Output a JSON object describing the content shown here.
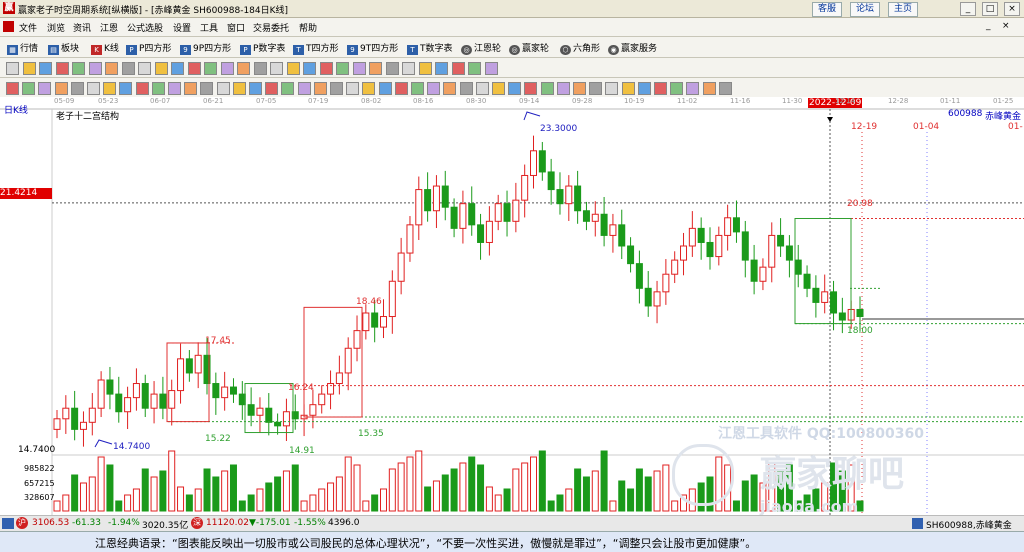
{
  "window": {
    "title": "赢家老子时空周期系统[纵横版] - [赤峰黄金  SH600988-184日K线]",
    "links": [
      "客服",
      "论坛",
      "主页"
    ],
    "controls": [
      "_",
      "□",
      "×"
    ],
    "logo_text": "赢"
  },
  "menu": [
    "文件",
    "浏览",
    "资讯",
    "江恩",
    "公式选股",
    "设置",
    "工具",
    "窗口",
    "交易委托",
    "帮助"
  ],
  "toolbar1": [
    {
      "icon": "grid-icon",
      "label": "行情"
    },
    {
      "icon": "blocks-icon",
      "label": "板块"
    },
    {
      "icon": "kline-icon",
      "label": "K线"
    },
    {
      "icon": "p-square-icon",
      "label": "P四方形"
    },
    {
      "icon": "9p-square-icon",
      "label": "9P四方形"
    },
    {
      "icon": "pnum-table-icon",
      "label": "P数字表"
    },
    {
      "icon": "t-square-icon",
      "label": "T四方形"
    },
    {
      "icon": "9t-square-icon",
      "label": "9T四方形"
    },
    {
      "icon": "tnum-table-icon",
      "label": "T数字表"
    },
    {
      "icon": "gann-wheel-icon",
      "label": "江恩轮"
    },
    {
      "icon": "yingjia-wheel-icon",
      "label": "赢家轮"
    },
    {
      "icon": "hexagon-icon",
      "label": "六角形"
    },
    {
      "icon": "yingjia-service-icon",
      "label": "赢家服务"
    }
  ],
  "chart_header": {
    "period": "日K线",
    "indicator": "老子十二宫结构",
    "code": "600988",
    "name": "赤峰黄金",
    "crosshair_date": "2022-12-09",
    "crosshair_price": "21.4214",
    "right_edge_label": "01-"
  },
  "date_axis": [
    "05-09",
    "05-23",
    "06-07",
    "06-21",
    "07-05",
    "07-19",
    "08-02",
    "08-16",
    "08-30",
    "09-14",
    "09-28",
    "10-19",
    "11-02",
    "11-16",
    "11-30",
    "12-14",
    "12-28",
    "01-11",
    "01-25"
  ],
  "annotations": {
    "hi_peak": "23.3000",
    "lo_start": "14.7400",
    "axis_low": "14.7400",
    "box1_high": "17.45",
    "box1_low": "15.22",
    "box2_low": "14.91",
    "box3_high": "18.46",
    "box3_mid": "16.24",
    "box3_low": "15.35",
    "box4_high": "20.98",
    "box4_low": "18.00",
    "future_date1": "12-19",
    "future_date2": "01-04"
  },
  "volume_axis": [
    "985822",
    "657215",
    "328607"
  ],
  "watermark": {
    "line1": "江恩工具软件 QQ:100800360",
    "line2": "赢家聊吧",
    "line3": "jiaoba.com"
  },
  "status": {
    "sh_index": "3106.53",
    "sh_change": "-61.33",
    "sh_pct": "-1.94%",
    "sh_amount": "3020.35亿",
    "sz_index": "11120.02",
    "sz_change": "▼-175.01",
    "sz_pct": "-1.55%",
    "sz_amount": "4396.0",
    "right": "SH600988,赤峰黄金"
  },
  "quote": "江恩经典语录：“图表能反映出一切股市或公司股民的总体心理状况”，“不要一次性买进，傲慢就是罪过”，“调整只会让股市更加健康”。",
  "colors": {
    "up": "#e02020",
    "down": "#1a9a1a",
    "crosshair_label_bg": "#e00000",
    "box_red": "#e03030",
    "box_green": "#30a030"
  },
  "chart_data": {
    "type": "candlestick",
    "title": "赤峰黄金 SH600988 日K线",
    "x": [
      "05-09",
      "05-23",
      "06-07",
      "06-21",
      "07-05",
      "07-19",
      "08-02",
      "08-16",
      "08-30",
      "09-14",
      "09-28",
      "10-19",
      "11-02",
      "11-16",
      "11-30",
      "12-14",
      "12-28",
      "01-11",
      "01-25"
    ],
    "y_marks": {
      "high": 23.3,
      "low": 14.74,
      "crosshair": 21.4214
    },
    "ylim": [
      14.5,
      24.0
    ],
    "close_path": [
      15.3,
      15.6,
      15.0,
      15.2,
      15.6,
      16.4,
      16.0,
      15.5,
      15.9,
      16.3,
      15.6,
      16.0,
      15.6,
      16.1,
      17.0,
      16.6,
      17.1,
      16.3,
      15.9,
      16.2,
      16.0,
      15.7,
      15.4,
      15.6,
      15.2,
      15.1,
      15.5,
      15.3,
      15.4,
      15.7,
      16.0,
      16.3,
      16.6,
      17.3,
      17.8,
      18.3,
      17.9,
      18.2,
      19.2,
      20.0,
      20.8,
      21.8,
      21.2,
      21.9,
      21.3,
      20.7,
      21.4,
      20.8,
      20.3,
      20.9,
      21.4,
      20.9,
      21.5,
      22.2,
      22.9,
      22.3,
      21.8,
      21.4,
      21.9,
      21.2,
      20.9,
      21.1,
      20.5,
      20.8,
      20.2,
      19.7,
      19.0,
      18.5,
      18.9,
      19.4,
      19.8,
      20.2,
      20.7,
      20.3,
      19.9,
      20.5,
      21.0,
      20.6,
      19.8,
      19.2,
      19.6,
      20.5,
      20.2,
      19.8,
      19.4,
      19.0,
      18.6,
      18.9,
      18.3,
      18.1,
      18.4,
      18.2
    ],
    "volume": {
      "ticks": [
        328607,
        657215,
        985822
      ]
    },
    "boxes": [
      {
        "high": 17.45,
        "low": 15.22,
        "color": "red"
      },
      {
        "low": 14.91,
        "color": "green"
      },
      {
        "high": 18.46,
        "mid": 16.24,
        "low": 15.35,
        "color": "red"
      },
      {
        "high": 20.98,
        "low": 18.0,
        "color": "green"
      }
    ]
  }
}
